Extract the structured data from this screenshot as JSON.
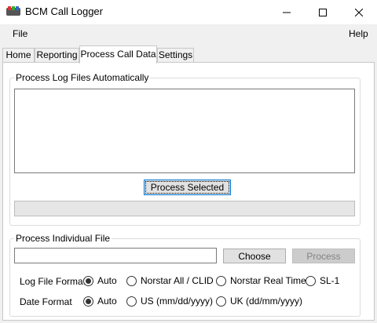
{
  "window": {
    "title": "BCM Call Logger"
  },
  "menu": {
    "file": "File",
    "help": "Help"
  },
  "tabs": [
    {
      "label": "Home",
      "active": false
    },
    {
      "label": "Reporting",
      "active": false
    },
    {
      "label": "Process Call Data",
      "active": true
    },
    {
      "label": "Settings",
      "active": false
    }
  ],
  "auto_group": {
    "title": "Process Log Files Automatically",
    "process_selected_label": "Process Selected",
    "progress_fraction": 0
  },
  "individual_group": {
    "title": "Process Individual File",
    "file_path_value": "",
    "choose_label": "Choose",
    "process_label": "Process"
  },
  "log_file_format": {
    "label": "Log File Format",
    "options": [
      {
        "label": "Auto",
        "checked": true
      },
      {
        "label": "Norstar All / CLID",
        "checked": false
      },
      {
        "label": "Norstar Real Time",
        "checked": false
      },
      {
        "label": "SL-1",
        "checked": false
      }
    ]
  },
  "date_format": {
    "label": "Date Format",
    "options": [
      {
        "label": "Auto",
        "checked": true
      },
      {
        "label": "US (mm/dd/yyyy)",
        "checked": false
      },
      {
        "label": "UK (dd/mm/yyyy)",
        "checked": false
      }
    ]
  },
  "colors": {
    "focus_border": "#0078d7",
    "disabled_button": "#cccccc"
  }
}
